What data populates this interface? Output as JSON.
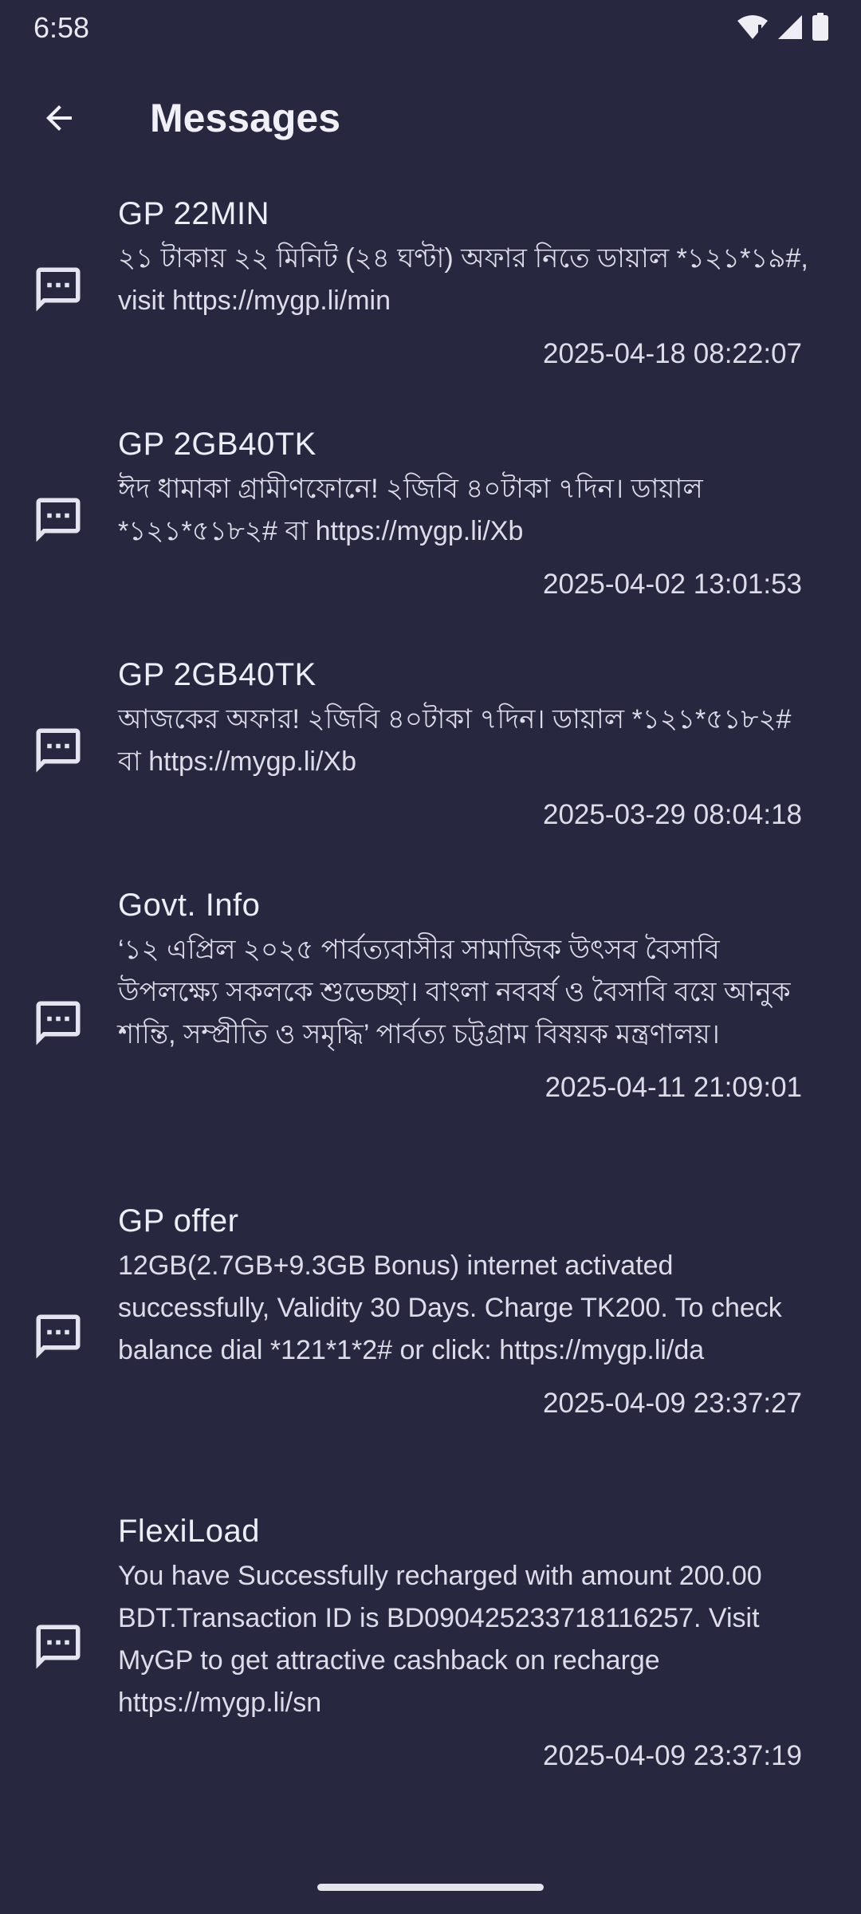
{
  "status_bar": {
    "time": "6:58"
  },
  "header": {
    "title": "Messages"
  },
  "messages": [
    {
      "sender": "GP 22MIN",
      "text": "২১ টাকায় ২২ মিনিট (২৪ ঘণ্টা) অফার নিতে ডায়াল *১২১*১৯#, visit https://mygp.li/min",
      "time": "2025-04-18 08:22:07"
    },
    {
      "sender": "GP 2GB40TK",
      "text": "ঈদ ধামাকা গ্রামীণফোনে! ২জিবি ৪০টাকা ৭দিন। ডায়াল *১২১*৫১৮২# বা https://mygp.li/Xb",
      "time": "2025-04-02 13:01:53"
    },
    {
      "sender": "GP 2GB40TK",
      "text": "আজকের অফার! ২জিবি ৪০টাকা ৭দিন। ডায়াল *১২১*৫১৮২# বা https://mygp.li/Xb",
      "time": "2025-03-29 08:04:18"
    },
    {
      "sender": "Govt. Info",
      "text": "‘১২ এপ্রিল ২০২৫ পার্বত্যবাসীর সামাজিক উৎসব বৈসাবি উপলক্ষ্যে সকলকে শুভেচ্ছা। বাংলা নববর্ষ ও বৈসাবি বয়ে আনুক শান্তি, সম্প্রীতি ও সমৃদ্ধি’ পার্বত্য চট্টগ্রাম বিষয়ক মন্ত্রণালয়।",
      "time": "2025-04-11 21:09:01"
    },
    {
      "sender": "GP offer",
      "text": "12GB(2.7GB+9.3GB Bonus) internet activated successfully, Validity 30 Days. Charge TK200. To check balance dial *121*1*2# or click: https://mygp.li/da",
      "time": "2025-04-09 23:37:27"
    },
    {
      "sender": "FlexiLoad",
      "text": "You have Successfully recharged with amount 200.00 BDT.Transaction ID is BD090425233718116257. Visit MyGP to get attractive cashback on recharge https://mygp.li/sn",
      "time": "2025-04-09 23:37:19"
    }
  ]
}
